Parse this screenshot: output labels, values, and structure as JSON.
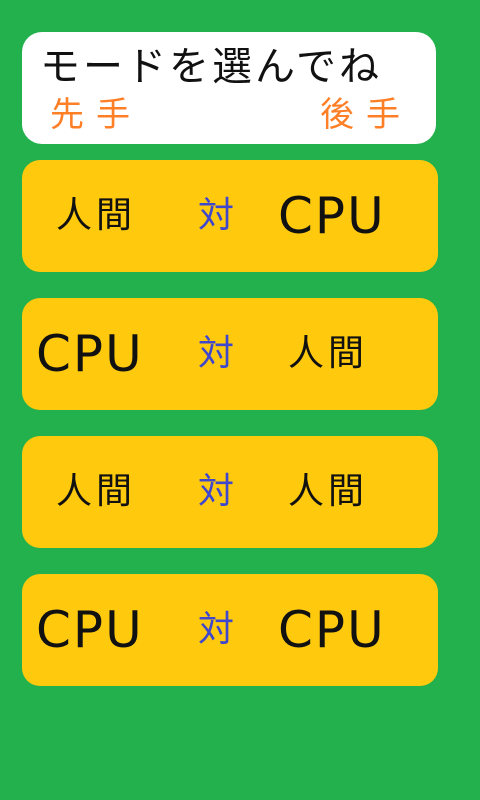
{
  "header": {
    "title": "モードを選んでね",
    "first_label": "先手",
    "second_label": "後手"
  },
  "modes": [
    {
      "first": "人間",
      "vs": "対",
      "second": "CPU"
    },
    {
      "first": "CPU",
      "vs": "対",
      "second": "人間"
    },
    {
      "first": "人間",
      "vs": "対",
      "second": "人間"
    },
    {
      "first": "CPU",
      "vs": "対",
      "second": "CPU"
    }
  ],
  "colors": {
    "background": "#22b14c",
    "header_bg": "#ffffff",
    "button_bg": "#ffc90e",
    "turn_label": "#ff7f27",
    "vs_text": "#3f48cc",
    "text": "#111111"
  }
}
